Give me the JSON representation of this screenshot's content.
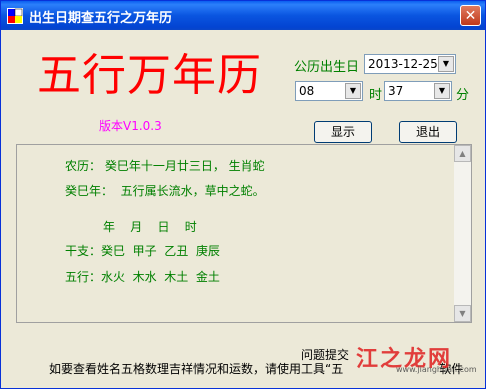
{
  "window": {
    "title": "出生日期查五行之万年历",
    "close_glyph": "✕"
  },
  "header": {
    "app_title": "五行万年历",
    "version": "版本V1.0.3"
  },
  "form": {
    "birth_label": "公历出生日",
    "date_value": "2013-12-25",
    "hour_value": "08",
    "hour_unit": "时",
    "minute_value": "37",
    "minute_unit": "分"
  },
  "buttons": {
    "show": "显示",
    "exit": "退出"
  },
  "result": {
    "lunar": "农历： 癸巳年十一月廿三日， 生肖蛇",
    "year_desc": "癸巳年：  五行属长流水，草中之蛇。",
    "col_headers": "年    月    日    时",
    "ganzhi": "干支：癸巳  甲子  乙丑  庚辰",
    "wuxing": "五行：水火  木水  木土  金土"
  },
  "footer": {
    "link": "问题提交",
    "text": "如要查看姓名五格数理吉祥情况和运数，请使用工具“五",
    "text_tail": "软件"
  },
  "watermark": {
    "brand": "江之龙网",
    "url": "www.jianghuan.com"
  },
  "colors": {
    "title_red": "#ff0000",
    "version_magenta": "#ff00ff",
    "text_green": "#008000",
    "titlebar_blue": "#0a55e0"
  }
}
